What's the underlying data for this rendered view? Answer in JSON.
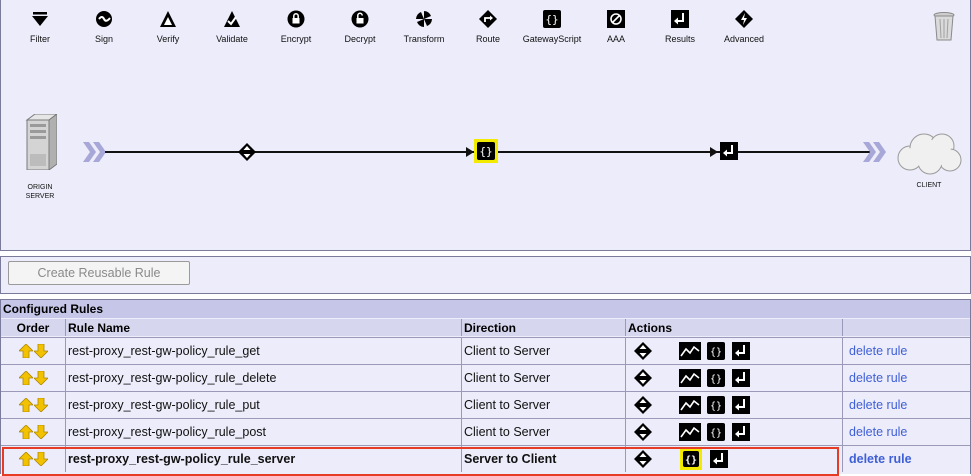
{
  "toolbar": {
    "tools": [
      {
        "label": "Filter",
        "icon": "filter-icon"
      },
      {
        "label": "Sign",
        "icon": "sign-icon"
      },
      {
        "label": "Verify",
        "icon": "verify-icon"
      },
      {
        "label": "Validate",
        "icon": "validate-icon"
      },
      {
        "label": "Encrypt",
        "icon": "encrypt-icon"
      },
      {
        "label": "Decrypt",
        "icon": "decrypt-icon"
      },
      {
        "label": "Transform",
        "icon": "transform-icon"
      },
      {
        "label": "Route",
        "icon": "route-icon"
      },
      {
        "label": "GatewayScript",
        "icon": "gatewayscript-icon"
      },
      {
        "label": "AAA",
        "icon": "aaa-icon"
      },
      {
        "label": "Results",
        "icon": "results-icon"
      },
      {
        "label": "Advanced",
        "icon": "advanced-icon"
      }
    ],
    "trash_icon": "trash-icon"
  },
  "diagram": {
    "origin_label_line1": "ORIGIN",
    "origin_label_line2": "SERVER",
    "client_label": "CLIENT",
    "nodes": [
      "match-icon",
      "gatewayscript-icon",
      "results-icon"
    ],
    "selected_node_color": "#f2ea00"
  },
  "create_button_label": "Create Reusable Rule",
  "rules": {
    "title": "Configured Rules",
    "headers": {
      "order": "Order",
      "name": "Rule Name",
      "direction": "Direction",
      "actions": "Actions"
    },
    "rows": [
      {
        "name": "rest-proxy_rest-gw-policy_rule_get",
        "direction": "Client to Server",
        "delete": "delete rule"
      },
      {
        "name": "rest-proxy_rest-gw-policy_rule_delete",
        "direction": "Client to Server",
        "delete": "delete rule"
      },
      {
        "name": "rest-proxy_rest-gw-policy_rule_put",
        "direction": "Client to Server",
        "delete": "delete rule"
      },
      {
        "name": "rest-proxy_rest-gw-policy_rule_post",
        "direction": "Client to Server",
        "delete": "delete rule"
      },
      {
        "name": "rest-proxy_rest-gw-policy_rule_server",
        "direction": "Server to Client",
        "delete": "delete rule"
      }
    ],
    "selected_row": 5,
    "highlight_color": "#e63b24",
    "link_color": "#3f5fd6",
    "arrow_color": "#f2c200"
  }
}
